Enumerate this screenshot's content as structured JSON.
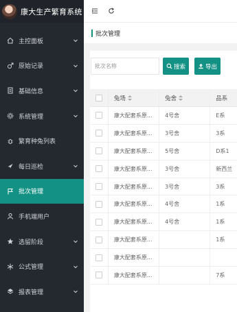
{
  "app": {
    "title": "康大生产繁育系统"
  },
  "sidebar": {
    "items": [
      {
        "label": "主控面板",
        "icon": "home-icon",
        "expandable": true,
        "active": false
      },
      {
        "label": "原始记录",
        "icon": "male-icon",
        "expandable": true,
        "active": false
      },
      {
        "label": "基础信息",
        "icon": "document-icon",
        "expandable": true,
        "active": false
      },
      {
        "label": "系统管理",
        "icon": "gear-icon",
        "expandable": true,
        "active": false
      },
      {
        "label": "繁育种兔列表",
        "icon": "bug-icon",
        "expandable": false,
        "active": false
      },
      {
        "label": "每日巡检",
        "icon": "compass-icon",
        "expandable": true,
        "active": false
      },
      {
        "label": "批次管理",
        "icon": "flag-icon",
        "expandable": false,
        "active": true
      },
      {
        "label": "手机端用户",
        "icon": "user-icon",
        "expandable": false,
        "active": false
      },
      {
        "label": "选留阶段",
        "icon": "star-icon",
        "expandable": true,
        "active": false
      },
      {
        "label": "公式管理",
        "icon": "snowflake-icon",
        "expandable": true,
        "active": false
      },
      {
        "label": "报表管理",
        "icon": "layers-icon",
        "expandable": true,
        "active": false
      }
    ]
  },
  "topbar": {
    "menu_icon": "menu-toggle-icon",
    "refresh_icon": "refresh-icon"
  },
  "page": {
    "title": "批次管理"
  },
  "search": {
    "placeholder": "批次名称",
    "search_label": "搜索",
    "export_label": "导出"
  },
  "table": {
    "headers": [
      "兔场",
      "兔舍",
      "品系"
    ],
    "rows": [
      [
        "康大配套系原...",
        "4号舍",
        "E系"
      ],
      [
        "康大配套系原...",
        "3号舍",
        "3系"
      ],
      [
        "康大配套系原...",
        "5号舍",
        "D系1"
      ],
      [
        "康大配套系原...",
        "3号舍",
        "新西兰"
      ],
      [
        "康大配套系原...",
        "3号舍",
        "3系"
      ],
      [
        "康大配套系原...",
        "4号舍",
        "1系"
      ],
      [
        "康大配套系原...",
        "4号舍",
        "1系"
      ],
      [
        "康大配套系原...",
        "",
        "1系"
      ],
      [
        "康大配套系原...",
        "",
        ""
      ],
      [
        "康大配套系原...",
        "",
        "7系"
      ]
    ]
  },
  "colors": {
    "accent": "#139184",
    "sidebar_bg": "#24292f"
  }
}
